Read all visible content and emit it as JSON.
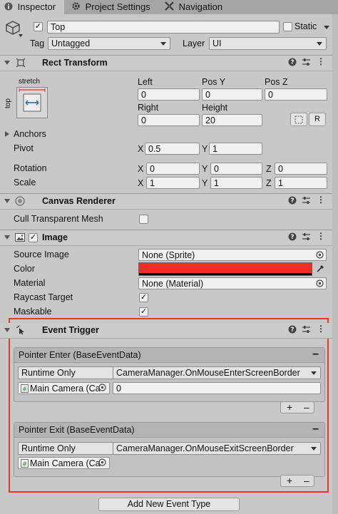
{
  "tabs": [
    {
      "label": "Inspector",
      "icon": "info-icon",
      "active": true
    },
    {
      "label": "Project Settings",
      "icon": "gear-icon",
      "active": false
    },
    {
      "label": "Navigation",
      "icon": "navigation-icon",
      "active": false
    }
  ],
  "object": {
    "name": "Top",
    "active": true,
    "static_label": "Static",
    "tag_label": "Tag",
    "tag_value": "Untagged",
    "layer_label": "Layer",
    "layer_value": "UI"
  },
  "rect_transform": {
    "title": "Rect Transform",
    "anchor_preset_top": "stretch",
    "anchor_preset_side": "top",
    "left_label": "Left",
    "left": "0",
    "posy_label": "Pos Y",
    "posy": "0",
    "posz_label": "Pos Z",
    "posz": "0",
    "right_label": "Right",
    "right": "0",
    "height_label": "Height",
    "height": "20",
    "raw_button": "R",
    "anchors_label": "Anchors",
    "pivot_label": "Pivot",
    "pivot_x_label": "X",
    "pivot_x": "0.5",
    "pivot_y_label": "Y",
    "pivot_y": "1",
    "rotation_label": "Rotation",
    "rot_x_label": "X",
    "rot_x": "0",
    "rot_y_label": "Y",
    "rot_y": "0",
    "rot_z_label": "Z",
    "rot_z": "0",
    "scale_label": "Scale",
    "scale_x_label": "X",
    "scale_x": "1",
    "scale_y_label": "Y",
    "scale_y": "1",
    "scale_z_label": "Z",
    "scale_z": "1"
  },
  "canvas_renderer": {
    "title": "Canvas Renderer",
    "cull_label": "Cull Transparent Mesh",
    "cull": false
  },
  "image": {
    "title": "Image",
    "enabled": true,
    "source_label": "Source Image",
    "source": "None (Sprite)",
    "color_label": "Color",
    "color": "#f22e24",
    "material_label": "Material",
    "material": "None (Material)",
    "raycast_label": "Raycast Target",
    "raycast": true,
    "maskable_label": "Maskable",
    "maskable": true
  },
  "event_trigger": {
    "title": "Event Trigger",
    "highlight_color": "#e63b22",
    "entries": [
      {
        "header": "Pointer Enter (BaseEventData)",
        "runtime": "Runtime Only",
        "function": "CameraManager.OnMouseEnterScreenBorder",
        "object": "Main Camera (Ca",
        "argument": "0"
      },
      {
        "header": "Pointer Exit (BaseEventData)",
        "runtime": "Runtime Only",
        "function": "CameraManager.OnMouseExitScreenBorder",
        "object": "Main Camera (Ca",
        "argument": ""
      }
    ],
    "add_button": "Add New Event Type"
  }
}
